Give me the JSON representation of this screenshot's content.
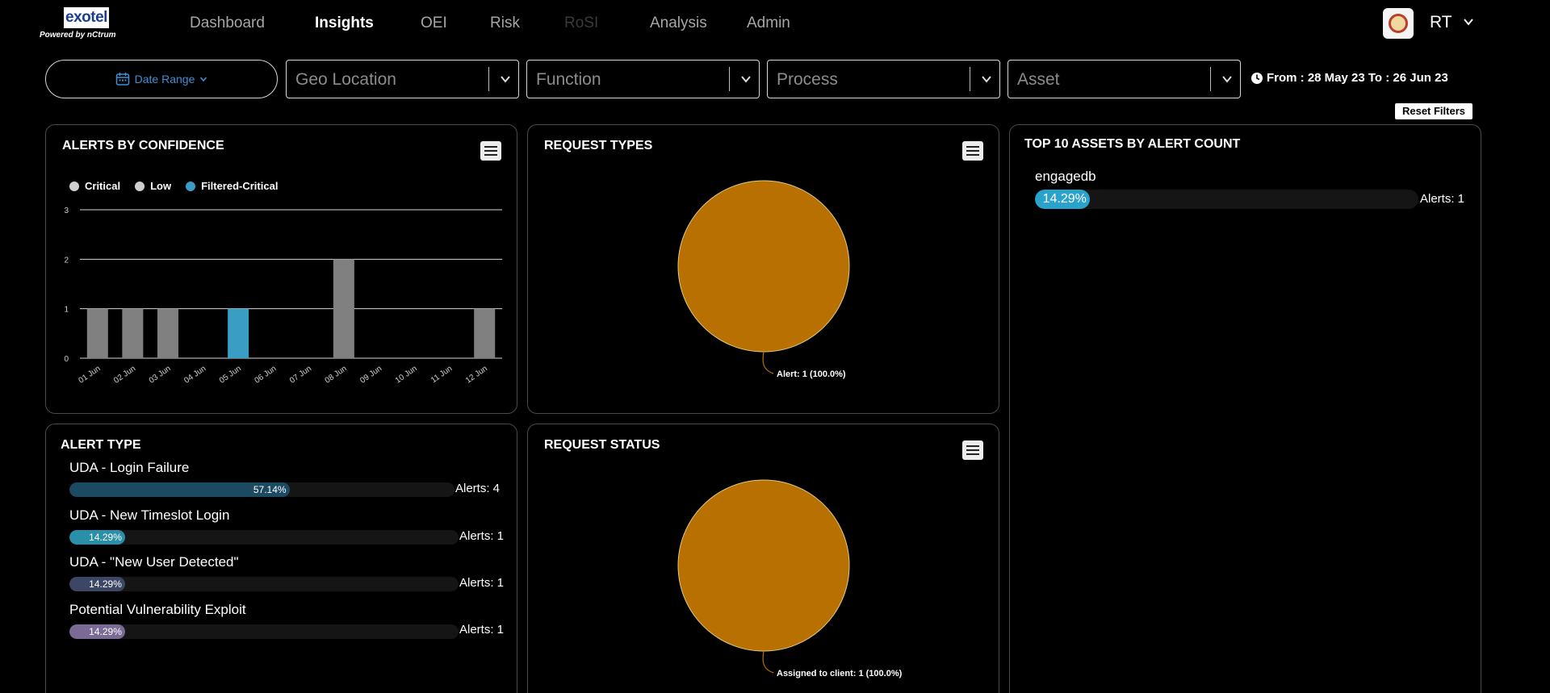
{
  "brand": {
    "logo_text": "exotel",
    "powered_by": "Powered by nCtrum"
  },
  "nav": {
    "items": [
      {
        "label": "Dashboard",
        "state": "normal"
      },
      {
        "label": "Insights",
        "state": "active"
      },
      {
        "label": "OEI",
        "state": "normal"
      },
      {
        "label": "Risk",
        "state": "normal"
      },
      {
        "label": "RoSI",
        "state": "disabled"
      },
      {
        "label": "Analysis",
        "state": "normal"
      },
      {
        "label": "Admin",
        "state": "normal"
      }
    ]
  },
  "user": {
    "initials": "RT",
    "avatar_icon": "emblem-avatar-icon"
  },
  "filters": {
    "date_range_label": "Date Range",
    "geo_placeholder": "Geo Location",
    "function_placeholder": "Function",
    "process_placeholder": "Process",
    "asset_placeholder": "Asset",
    "date_info": "From : 28 May 23 To : 26 Jun 23",
    "reset_label": "Reset Filters"
  },
  "alerts_by_confidence": {
    "title": "ALERTS BY CONFIDENCE",
    "legend": [
      {
        "label": "Critical",
        "color": "#cfcfcf"
      },
      {
        "label": "Low",
        "color": "#cfcfcf"
      },
      {
        "label": "Filtered-Critical",
        "color": "#3a9ec4"
      }
    ]
  },
  "request_types": {
    "title": "REQUEST TYPES"
  },
  "request_status": {
    "title": "REQUEST STATUS"
  },
  "top_assets": {
    "title": "TOP 10 ASSETS BY ALERT COUNT",
    "rows": [
      {
        "name": "engagedb",
        "percent_label": "14.29%",
        "fraction": 0.1429,
        "count_label": "Alerts: 1",
        "color": "#2aa3cc"
      }
    ]
  },
  "alert_type": {
    "title": "ALERT TYPE",
    "rows": [
      {
        "name": "UDA - Login Failure",
        "percent_label": "57.14%",
        "fraction": 0.5714,
        "count_label": "Alerts: 4",
        "color": "#1c4a63"
      },
      {
        "name": "UDA - New Timeslot Login",
        "percent_label": "14.29%",
        "fraction": 0.1429,
        "count_label": "Alerts: 1",
        "color": "#2a8fa8"
      },
      {
        "name": "UDA - \"New User Detected\"",
        "percent_label": "14.29%",
        "fraction": 0.1429,
        "count_label": "Alerts: 1",
        "color": "#3c4766"
      },
      {
        "name": "Potential Vulnerability Exploit",
        "percent_label": "14.29%",
        "fraction": 0.1429,
        "count_label": "Alerts: 1",
        "color": "#7a6b96"
      }
    ]
  },
  "chart_data": [
    {
      "type": "bar",
      "title": "ALERTS BY CONFIDENCE",
      "categories": [
        "01 Jun",
        "02 Jun",
        "03 Jun",
        "04 Jun",
        "05 Jun",
        "06 Jun",
        "07 Jun",
        "08 Jun",
        "09 Jun",
        "10 Jun",
        "11 Jun",
        "12 Jun"
      ],
      "series": [
        {
          "name": "Critical",
          "color": "#808080",
          "values": [
            1,
            1,
            1,
            0,
            0,
            0,
            0,
            2,
            0,
            0,
            0,
            1
          ]
        },
        {
          "name": "Low",
          "color": "#808080",
          "values": [
            0,
            0,
            0,
            0,
            0,
            0,
            0,
            0,
            0,
            0,
            0,
            0
          ]
        },
        {
          "name": "Filtered-Critical",
          "color": "#3a9ec4",
          "values": [
            0,
            0,
            0,
            0,
            1,
            0,
            0,
            0,
            0,
            0,
            0,
            0
          ]
        }
      ],
      "yticks": [
        0,
        1,
        2,
        3
      ],
      "ylim": [
        0,
        3
      ],
      "grid": true,
      "legend": "top-left"
    },
    {
      "type": "pie",
      "title": "REQUEST TYPES",
      "slices": [
        {
          "label": "Alert",
          "value": 1,
          "percent": 100.0,
          "color": "#b87000"
        }
      ],
      "data_labels": [
        "Alert: 1 (100.0%)"
      ]
    },
    {
      "type": "pie",
      "title": "REQUEST STATUS",
      "slices": [
        {
          "label": "Assigned to client",
          "value": 1,
          "percent": 100.0,
          "color": "#b87000"
        }
      ],
      "data_labels": [
        "Assigned to client: 1 (100.0%)"
      ]
    }
  ]
}
